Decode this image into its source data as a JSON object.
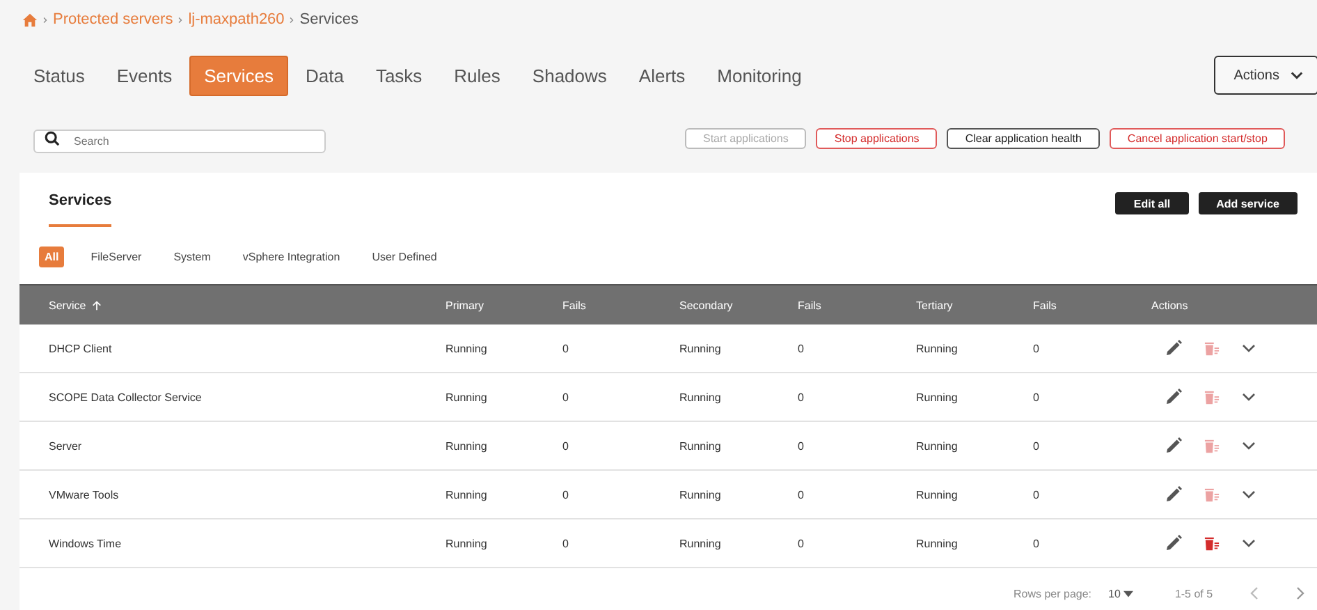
{
  "breadcrumb": [
    {
      "label": "Protected servers",
      "link": true
    },
    {
      "label": "lj-maxpath260",
      "link": true
    },
    {
      "label": "Services",
      "link": false
    }
  ],
  "tabs": [
    {
      "label": "Status",
      "selected": false
    },
    {
      "label": "Events",
      "selected": false
    },
    {
      "label": "Services",
      "selected": true
    },
    {
      "label": "Data",
      "selected": false
    },
    {
      "label": "Tasks",
      "selected": false
    },
    {
      "label": "Rules",
      "selected": false
    },
    {
      "label": "Shadows",
      "selected": false
    },
    {
      "label": "Alerts",
      "selected": false
    },
    {
      "label": "Monitoring",
      "selected": false
    }
  ],
  "actions_menu": {
    "label": "Actions"
  },
  "search": {
    "placeholder": "Search"
  },
  "toolbar_buttons": [
    {
      "label": "Start applications",
      "kind": "disabled"
    },
    {
      "label": "Stop applications",
      "kind": "danger"
    },
    {
      "label": "Clear application health",
      "kind": "default"
    },
    {
      "label": "Cancel application start/stop",
      "kind": "danger"
    }
  ],
  "card": {
    "title": "Services",
    "buttons": [
      "Edit all",
      "Add service"
    ],
    "filters": [
      {
        "label": "All",
        "selected": true
      },
      {
        "label": "FileServer",
        "selected": false
      },
      {
        "label": "System",
        "selected": false
      },
      {
        "label": "vSphere Integration",
        "selected": false
      },
      {
        "label": "User Defined",
        "selected": false
      }
    ],
    "table": {
      "columns": [
        {
          "label": "Service",
          "sorted": true
        },
        {
          "label": "Primary",
          "sorted": false
        },
        {
          "label": "Fails",
          "sorted": false
        },
        {
          "label": "Secondary",
          "sorted": false
        },
        {
          "label": "Fails",
          "sorted": false
        },
        {
          "label": "Tertiary",
          "sorted": false
        },
        {
          "label": "Fails",
          "sorted": false
        },
        {
          "label": "Actions",
          "sorted": false
        }
      ],
      "rows": [
        {
          "cells": [
            "DHCP Client",
            "Running",
            "0",
            "Running",
            "0",
            "Running",
            "0"
          ],
          "delete_enabled": false
        },
        {
          "cells": [
            "SCOPE Data Collector Service",
            "Running",
            "0",
            "Running",
            "0",
            "Running",
            "0"
          ],
          "delete_enabled": false
        },
        {
          "cells": [
            "Server",
            "Running",
            "0",
            "Running",
            "0",
            "Running",
            "0"
          ],
          "delete_enabled": false
        },
        {
          "cells": [
            "VMware Tools",
            "Running",
            "0",
            "Running",
            "0",
            "Running",
            "0"
          ],
          "delete_enabled": false
        },
        {
          "cells": [
            "Windows Time",
            "Running",
            "0",
            "Running",
            "0",
            "Running",
            "0"
          ],
          "delete_enabled": true
        }
      ]
    },
    "pagination": {
      "rows_per_page_label": "Rows per page:",
      "rows_per_page": "10",
      "range": "1-5 of 5"
    }
  }
}
